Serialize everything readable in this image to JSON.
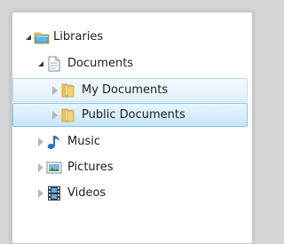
{
  "tree": {
    "libraries": {
      "label": "Libraries",
      "icon": "libraries-folder-icon",
      "expanded": true
    },
    "documents": {
      "label": "Documents",
      "icon": "document-library-icon",
      "expanded": true
    },
    "my_documents": {
      "label": "My Documents",
      "icon": "folder-icon",
      "expanded": false
    },
    "public_documents": {
      "label": "Public Documents",
      "icon": "folder-icon",
      "expanded": false
    },
    "music": {
      "label": "Music",
      "icon": "music-note-icon",
      "expanded": false
    },
    "pictures": {
      "label": "Pictures",
      "icon": "pictures-icon",
      "expanded": false
    },
    "videos": {
      "label": "Videos",
      "icon": "video-film-icon",
      "expanded": false
    }
  },
  "colors": {
    "selection_border": "#84c3ee",
    "hover_border": "#bcdcf4",
    "folder_yellow": "#f3c64a",
    "music_blue": "#2a6fd1"
  }
}
